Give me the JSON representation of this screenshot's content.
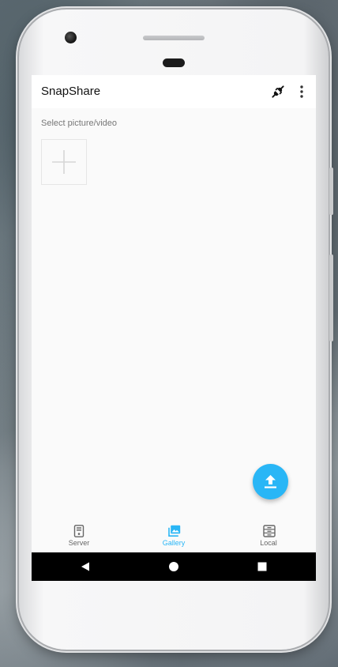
{
  "app": {
    "title": "SnapShare"
  },
  "toolbar": {
    "connect_icon": "plug-disconnected-icon",
    "menu_icon": "more-vert-icon"
  },
  "gallery": {
    "section_label": "Select picture/video",
    "add_icon": "plus-icon"
  },
  "fab": {
    "icon": "upload-icon",
    "color": "#29b6f6"
  },
  "bottom_nav": {
    "items": [
      {
        "label": "Server",
        "icon": "server-icon",
        "active": false
      },
      {
        "label": "Gallery",
        "icon": "gallery-icon",
        "active": true
      },
      {
        "label": "Local",
        "icon": "local-storage-icon",
        "active": false
      }
    ]
  },
  "system_nav": {
    "back_icon": "back-triangle-icon",
    "home_icon": "home-circle-icon",
    "recents_icon": "recents-square-icon"
  },
  "colors": {
    "accent": "#29b6f6",
    "appbar": "#ffffff",
    "background": "#fafafa",
    "system_bar": "#000000"
  }
}
